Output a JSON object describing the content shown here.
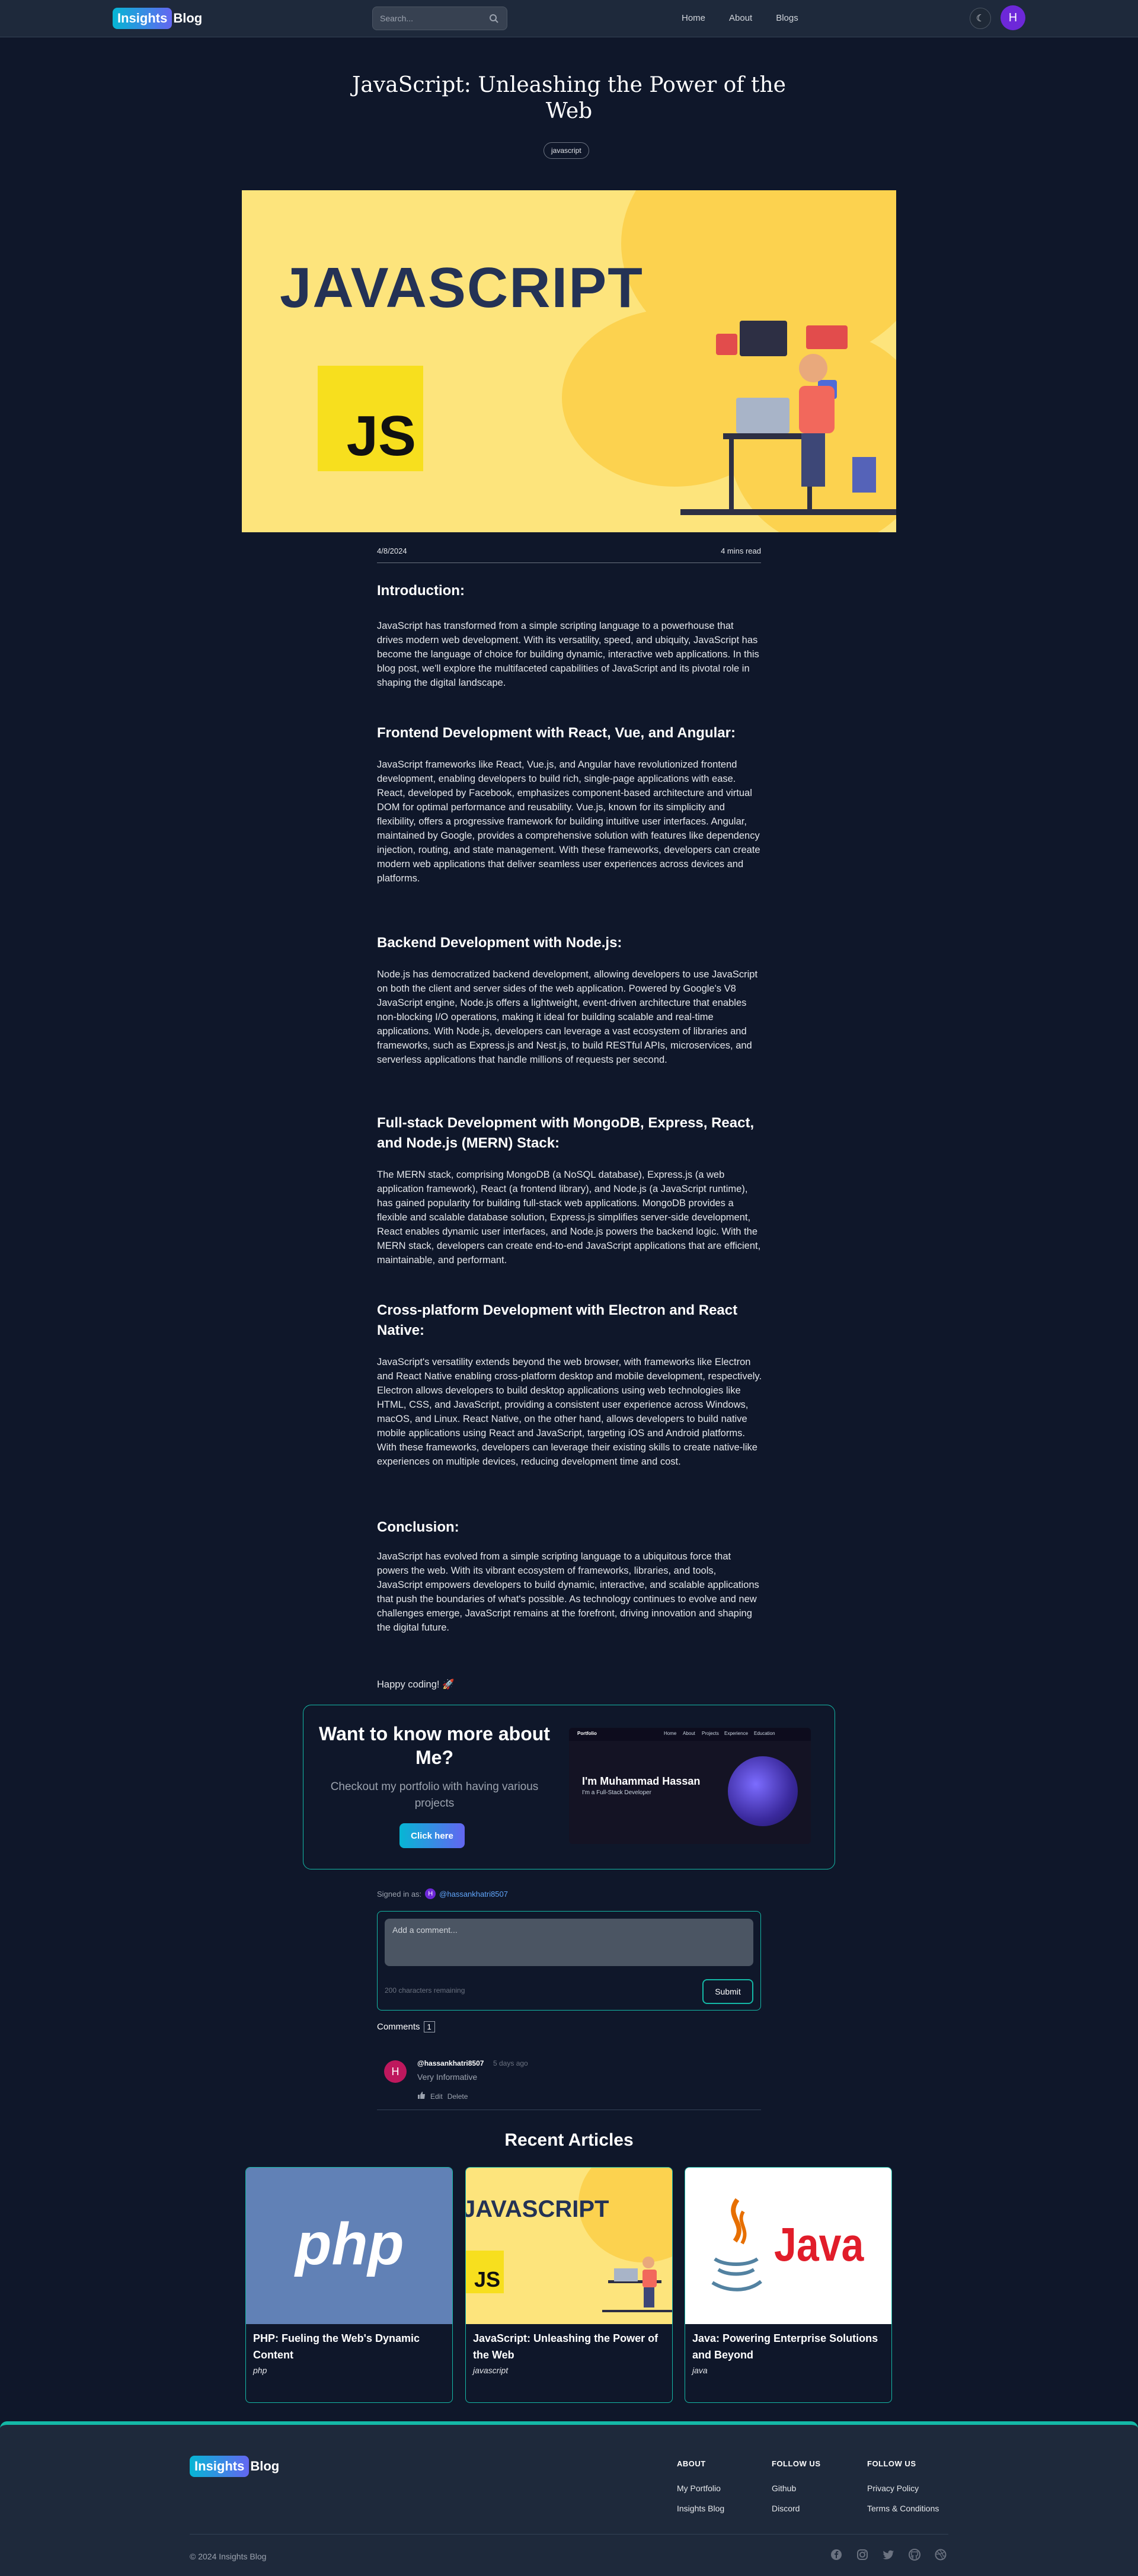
{
  "header": {
    "logo_part1": "Insights",
    "logo_part2": "Blog",
    "search_placeholder": "Search...",
    "nav": [
      "Home",
      "About",
      "Blogs"
    ],
    "theme_icon": "moon-icon",
    "avatar_letter": "H"
  },
  "post": {
    "title": "JavaScript: Unleashing the Power of the Web",
    "tag": "javascript",
    "hero_text": "JAVASCRIPT",
    "hero_logo_text": "JS",
    "date": "4/8/2024",
    "read_time": "4 mins read",
    "sections": [
      {
        "heading": "Introduction:",
        "text": "JavaScript has transformed from a simple scripting language to a powerhouse that drives modern web development. With its versatility, speed, and ubiquity, JavaScript has become the language of choice for building dynamic, interactive web applications. In this blog post, we'll explore the multifaceted capabilities of JavaScript and its pivotal role in shaping the digital landscape."
      },
      {
        "heading": "Frontend Development with React, Vue, and Angular:",
        "text": "JavaScript frameworks like React, Vue.js, and Angular have revolutionized frontend development, enabling developers to build rich, single-page applications with ease. React, developed by Facebook, emphasizes component-based architecture and virtual DOM for optimal performance and reusability. Vue.js, known for its simplicity and flexibility, offers a progressive framework for building intuitive user interfaces. Angular, maintained by Google, provides a comprehensive solution with features like dependency injection, routing, and state management. With these frameworks, developers can create modern web applications that deliver seamless user experiences across devices and platforms."
      },
      {
        "heading": "Backend Development with Node.js:",
        "text": "Node.js has democratized backend development, allowing developers to use JavaScript on both the client and server sides of the web application. Powered by Google's V8 JavaScript engine, Node.js offers a lightweight, event-driven architecture that enables non-blocking I/O operations, making it ideal for building scalable and real-time applications. With Node.js, developers can leverage a vast ecosystem of libraries and frameworks, such as Express.js and Nest.js, to build RESTful APIs, microservices, and serverless applications that handle millions of requests per second."
      },
      {
        "heading": "Full-stack Development with MongoDB, Express, React, and Node.js (MERN) Stack:",
        "text": "The MERN stack, comprising MongoDB (a NoSQL database), Express.js (a web application framework), React (a frontend library), and Node.js (a JavaScript runtime), has gained popularity for building full-stack web applications. MongoDB provides a flexible and scalable database solution, Express.js simplifies server-side development, React enables dynamic user interfaces, and Node.js powers the backend logic. With the MERN stack, developers can create end-to-end JavaScript applications that are efficient, maintainable, and performant."
      },
      {
        "heading": "Cross-platform Development with Electron and React Native:",
        "text": "JavaScript's versatility extends beyond the web browser, with frameworks like Electron and React Native enabling cross-platform desktop and mobile development, respectively. Electron allows developers to build desktop applications using web technologies like HTML, CSS, and JavaScript, providing a consistent user experience across Windows, macOS, and Linux. React Native, on the other hand, allows developers to build native mobile applications using React and JavaScript, targeting iOS and Android platforms. With these frameworks, developers can leverage their existing skills to create native-like experiences on multiple devices, reducing development time and cost."
      },
      {
        "heading": "Conclusion:",
        "text": "JavaScript has evolved from a simple scripting language to a ubiquitous force that powers the web. With its vibrant ecosystem of frameworks, libraries, and tools, JavaScript empowers developers to build dynamic, interactive, and scalable applications that push the boundaries of what's possible. As technology continues to evolve and new challenges emerge, JavaScript remains at the forefront, driving innovation and shaping the digital future."
      }
    ],
    "sign_off": "Happy coding! 🚀"
  },
  "portfolio": {
    "heading": "Want to know more about Me?",
    "text": "Checkout my portfolio with having various projects",
    "button": "Click here",
    "shot_name": "I'm Muhammad Hassan",
    "shot_role": "I'm a Full-Stack Developer",
    "shot_brand": "Portfolio",
    "shot_nav": [
      "Home",
      "About",
      "Projects",
      "Experience",
      "Education"
    ]
  },
  "comments": {
    "signed_in_label": "Signed in as:",
    "signed_in_letter": "H",
    "signed_in_user": "@hassankhatri8507",
    "placeholder": "Add a comment...",
    "remaining": "200 characters remaining",
    "submit": "Submit",
    "count_label": "Comments",
    "count": "1",
    "items": [
      {
        "letter": "H",
        "user": "@hassankhatri8507",
        "time": "5 days ago",
        "text": "Very Informative",
        "likes_icon": "thumbs-up-icon",
        "edit": "Edit",
        "delete": "Delete"
      }
    ]
  },
  "recent": {
    "heading": "Recent Articles",
    "cards": [
      {
        "title": "PHP: Fueling the Web's Dynamic Content",
        "tag": "php",
        "img_text": "php"
      },
      {
        "title": "JavaScript: Unleashing the Power of the Web",
        "tag": "javascript",
        "img_text": "JAVASCRIPT",
        "img_logo": "JS"
      },
      {
        "title": "Java: Powering Enterprise Solutions and Beyond",
        "tag": "java",
        "img_text": "Java"
      }
    ]
  },
  "footer": {
    "logo_part1": "Insights",
    "logo_part2": "Blog",
    "columns": [
      {
        "heading": "ABOUT",
        "links": [
          "My Portfolio",
          "Insights Blog"
        ]
      },
      {
        "heading": "FOLLOW US",
        "links": [
          "Github",
          "Discord"
        ]
      },
      {
        "heading": "FOLLOW US",
        "links": [
          "Privacy Policy",
          "Terms & Conditions"
        ]
      }
    ],
    "copyright": "© 2024 Insights Blog",
    "social_icons": [
      "facebook-icon",
      "instagram-icon",
      "twitter-icon",
      "github-icon",
      "dribbble-icon"
    ]
  },
  "colors": {
    "background": "#0f172a",
    "header": "#1e293b",
    "accent": "#14b8a6",
    "gradient_start": "#06b6d4",
    "gradient_end": "#6366f1",
    "avatar": "#6d28d9"
  }
}
